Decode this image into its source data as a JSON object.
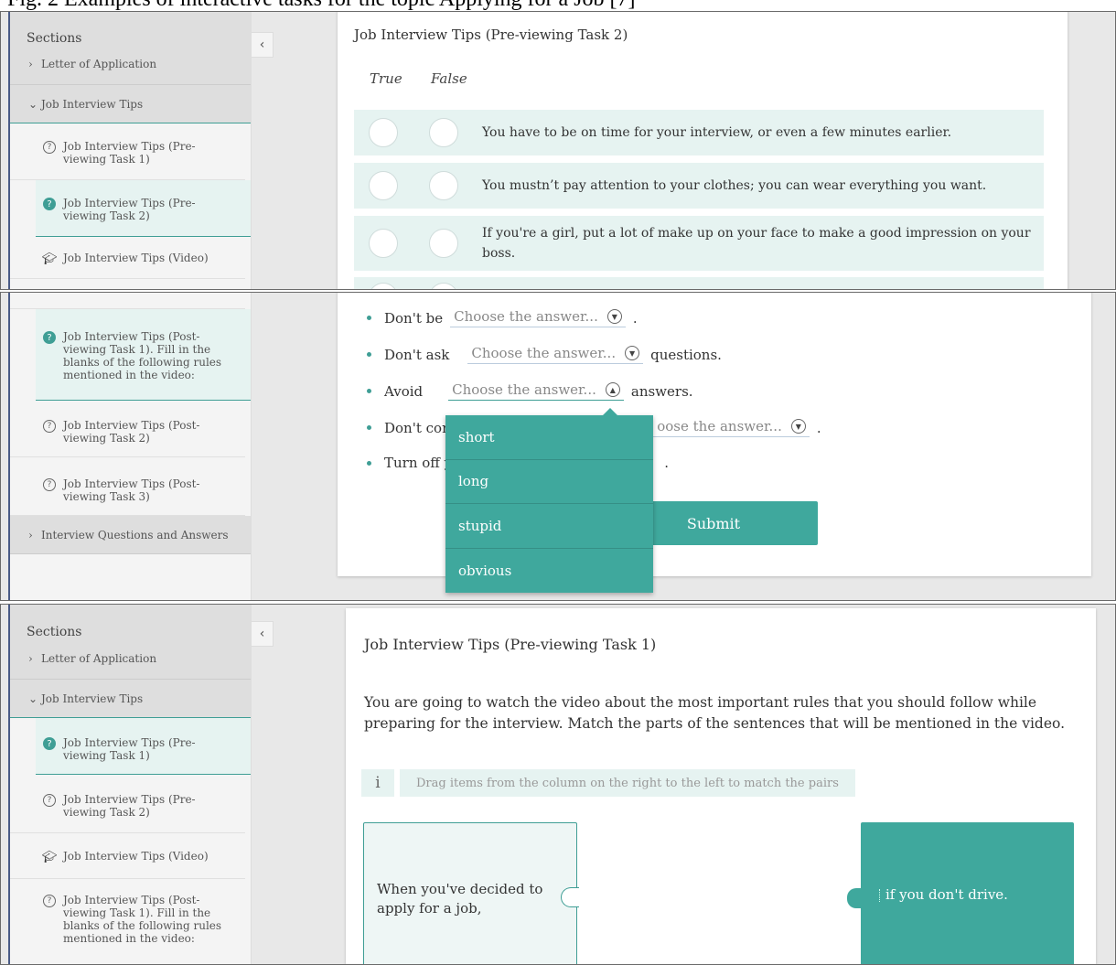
{
  "caption": "Fig. 2 Examples of interactive tasks for the topic Applying for a Job [7]",
  "colors": {
    "accent": "#3fa89d",
    "active_bg": "#e6f3f1"
  },
  "panel1": {
    "sidebar": {
      "heading": "Sections",
      "sections": [
        "Letter of Application",
        "Job Interview Tips"
      ],
      "items": [
        {
          "label": "Job Interview Tips (Pre-viewing Task 1)",
          "icon": "question-outline-icon"
        },
        {
          "label": "Job Interview Tips (Pre-viewing Task 2)",
          "icon": "question-filled-icon"
        },
        {
          "label": "Job Interview Tips (Video)",
          "icon": "graduation-cap-icon"
        }
      ]
    },
    "collapse": "‹",
    "title": "Job Interview Tips (Pre-viewing Task 2)",
    "true_label": "True",
    "false_label": "False",
    "statements": [
      "You have to be on time for your interview, or even a few minutes earlier.",
      "You mustn’t pay attention to your clothes; you can wear everything you want.",
      "If you're a girl, put a lot of make up on your face to make a good impression on your boss."
    ]
  },
  "panel2": {
    "sidebar": {
      "items": [
        {
          "label": "Job Interview Tips (Post-viewing Task 1). Fill in the blanks of the following rules mentioned in the video:",
          "icon": "question-filled-icon"
        },
        {
          "label": "Job Interview Tips (Post-viewing Task 2)",
          "icon": "question-outline-icon"
        },
        {
          "label": "Job Interview Tips (Post-viewing Task 3)",
          "icon": "question-outline-icon"
        }
      ],
      "section": "Interview Questions and Answers"
    },
    "placeholder": "Choose the answer...",
    "placeholder_cut": "oose the answer...",
    "rules": [
      {
        "before": "Don't be",
        "after": "."
      },
      {
        "before": "Don't ask",
        "after": "questions."
      },
      {
        "before": "Avoid",
        "after": "answers."
      },
      {
        "before": "Don't cor",
        "after": "."
      },
      {
        "before": "Turn off y",
        "after": "."
      }
    ],
    "options": [
      "short",
      "long",
      "stupid",
      "obvious"
    ],
    "submit": "Submit"
  },
  "panel3": {
    "sidebar": {
      "heading": "Sections",
      "sections": [
        "Letter of Application",
        "Job Interview Tips"
      ],
      "items": [
        {
          "label": "Job Interview Tips (Pre-viewing Task 1)",
          "icon": "question-filled-icon"
        },
        {
          "label": "Job Interview Tips (Pre-viewing Task 2)",
          "icon": "question-outline-icon"
        },
        {
          "label": "Job Interview Tips (Video)",
          "icon": "graduation-cap-icon"
        },
        {
          "label": "Job Interview Tips (Post-viewing Task 1). Fill in the blanks of the following rules mentioned in the video:",
          "icon": "question-outline-icon"
        }
      ]
    },
    "collapse": "‹",
    "title": "Job Interview Tips (Pre-viewing Task 1)",
    "instructions": "You are going to watch the video about the most important rules that you should follow while preparing for the interview. Match the parts of the sentences that will be mentioned in the video.",
    "info_icon": "i",
    "hint": "Drag items from the column on the right to the left to match the pairs",
    "left_item": "When you've decided to apply for a job,",
    "right_item": "if you don't drive."
  }
}
